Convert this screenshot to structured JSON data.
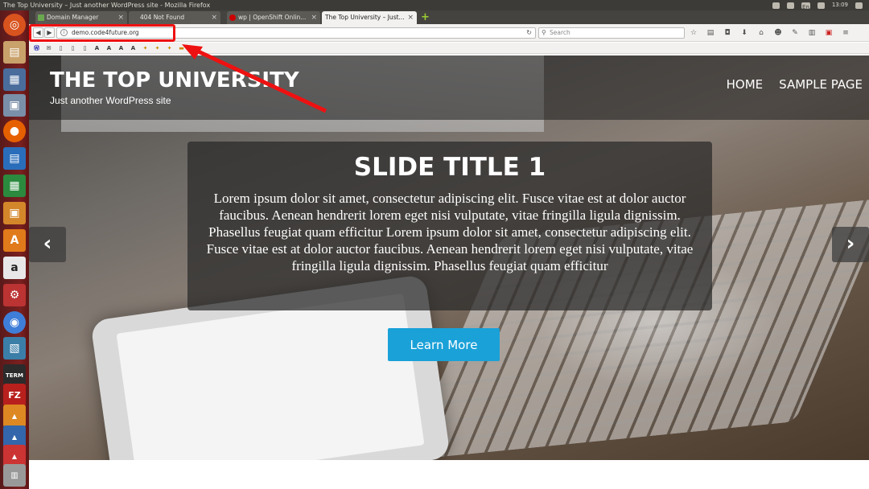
{
  "window": {
    "title": "The Top University – Just another WordPress site - Mozilla Firefox",
    "clock": "13:09",
    "lang": "En"
  },
  "tabs": [
    {
      "label": "Domain Manager",
      "favicon_color": "#6aa84f"
    },
    {
      "label": "404 Not Found",
      "favicon_color": ""
    },
    {
      "label": "wp | OpenShift Onlin...",
      "favicon_color": "#cc0000"
    },
    {
      "label": "The Top University – Just...",
      "favicon_color": ""
    }
  ],
  "navbar": {
    "url": "demo.code4future.org",
    "search_placeholder": "Search"
  },
  "site": {
    "title": "THE TOP UNIVERSITY",
    "tagline": "Just another WordPress site",
    "menu": [
      "HOME",
      "SAMPLE PAGE"
    ]
  },
  "slide": {
    "title": "SLIDE TITLE 1",
    "text": "Lorem ipsum dolor sit amet, consectetur adipiscing elit. Fusce vitae est at dolor auctor faucibus. Aenean hendrerit lorem eget nisi vulputate, vitae fringilla ligula dignissim. Phasellus feugiat quam efficitur Lorem ipsum dolor sit amet, consectetur adipiscing elit. Fusce vitae est at dolor auctor faucibus. Aenean hendrerit lorem eget nisi vulputate, vitae fringilla ligula dignissim. Phasellus feugiat quam efficitur",
    "button": "Learn More",
    "prev": "‹",
    "next": "›"
  },
  "colors": {
    "accent": "#1aa1d8",
    "annotation": "#ee1111"
  }
}
